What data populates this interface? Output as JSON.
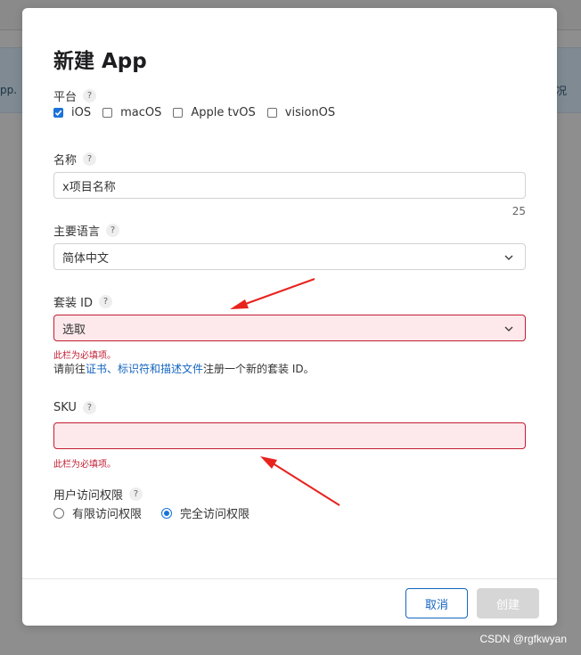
{
  "background": {
    "left_text": "pp.",
    "right_text": "况"
  },
  "dialog": {
    "title": "新建 App",
    "help_glyph": "?",
    "platform": {
      "label": "平台",
      "options": [
        {
          "label": "iOS",
          "checked": true
        },
        {
          "label": "macOS",
          "checked": false
        },
        {
          "label": "Apple tvOS",
          "checked": false
        },
        {
          "label": "visionOS",
          "checked": false
        }
      ]
    },
    "name": {
      "label": "名称",
      "value": "x项目名称",
      "remaining": "25"
    },
    "language": {
      "label": "主要语言",
      "value": "简体中文"
    },
    "bundle_id": {
      "label": "套装 ID",
      "value": "选取",
      "error": "此栏为必填项。",
      "note_prefix": "请前往",
      "note_link": "证书、标识符和描述文件",
      "note_suffix": "注册一个新的套装 ID。"
    },
    "sku": {
      "label": "SKU",
      "value": "",
      "error": "此栏为必填项。"
    },
    "user_access": {
      "label": "用户访问权限",
      "options": [
        {
          "label": "有限访问权限",
          "selected": false
        },
        {
          "label": "完全访问权限",
          "selected": true
        }
      ]
    },
    "buttons": {
      "cancel": "取消",
      "create": "创建"
    }
  },
  "watermark": "CSDN @rgfkwyan",
  "colors": {
    "accent": "#1a73d9",
    "link": "#1565c0",
    "error": "#c21d32",
    "error_bg": "#fde9ec",
    "annotation_arrow": "#e8231e"
  }
}
